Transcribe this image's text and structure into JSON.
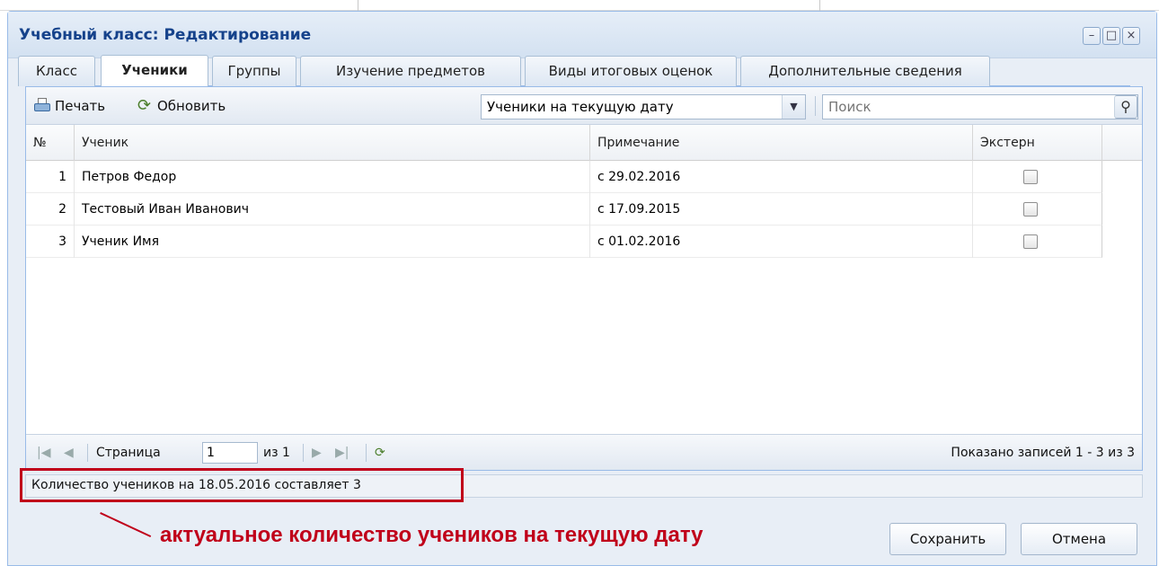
{
  "window": {
    "title": "Учебный класс: Редактирование"
  },
  "window_controls": {
    "minimize": "–",
    "maximize": "□",
    "close": "×"
  },
  "tabs": [
    {
      "label": "Класс"
    },
    {
      "label": "Ученики"
    },
    {
      "label": "Группы"
    },
    {
      "label": "Изучение предметов"
    },
    {
      "label": "Виды итоговых оценок"
    },
    {
      "label": "Дополнительные сведения"
    }
  ],
  "toolbar": {
    "print_label": "Печать",
    "refresh_label": "Обновить",
    "filter_selected": "Ученики на текущую дату",
    "search_placeholder": "Поиск"
  },
  "grid": {
    "columns": [
      "№",
      "Ученик",
      "Примечание",
      "Экстерн"
    ],
    "rows": [
      {
        "num": "1",
        "student": "Петров Федор",
        "note": "с 29.02.2016",
        "extern": false
      },
      {
        "num": "2",
        "student": "Тестовый Иван Иванович",
        "note": "с 17.09.2015",
        "extern": false
      },
      {
        "num": "3",
        "student": "Ученик Имя",
        "note": "с 01.02.2016",
        "extern": false
      }
    ]
  },
  "pager": {
    "page_label": "Страница",
    "page_value": "1",
    "of_label": "из 1",
    "records_text": "Показано записей 1 - 3 из 3"
  },
  "status": {
    "text": "Количество учеников на 18.05.2016 составляет 3"
  },
  "annotation": {
    "text": "актуальное количество учеников на текущую дату"
  },
  "buttons": {
    "save": "Сохранить",
    "cancel": "Отмена"
  }
}
